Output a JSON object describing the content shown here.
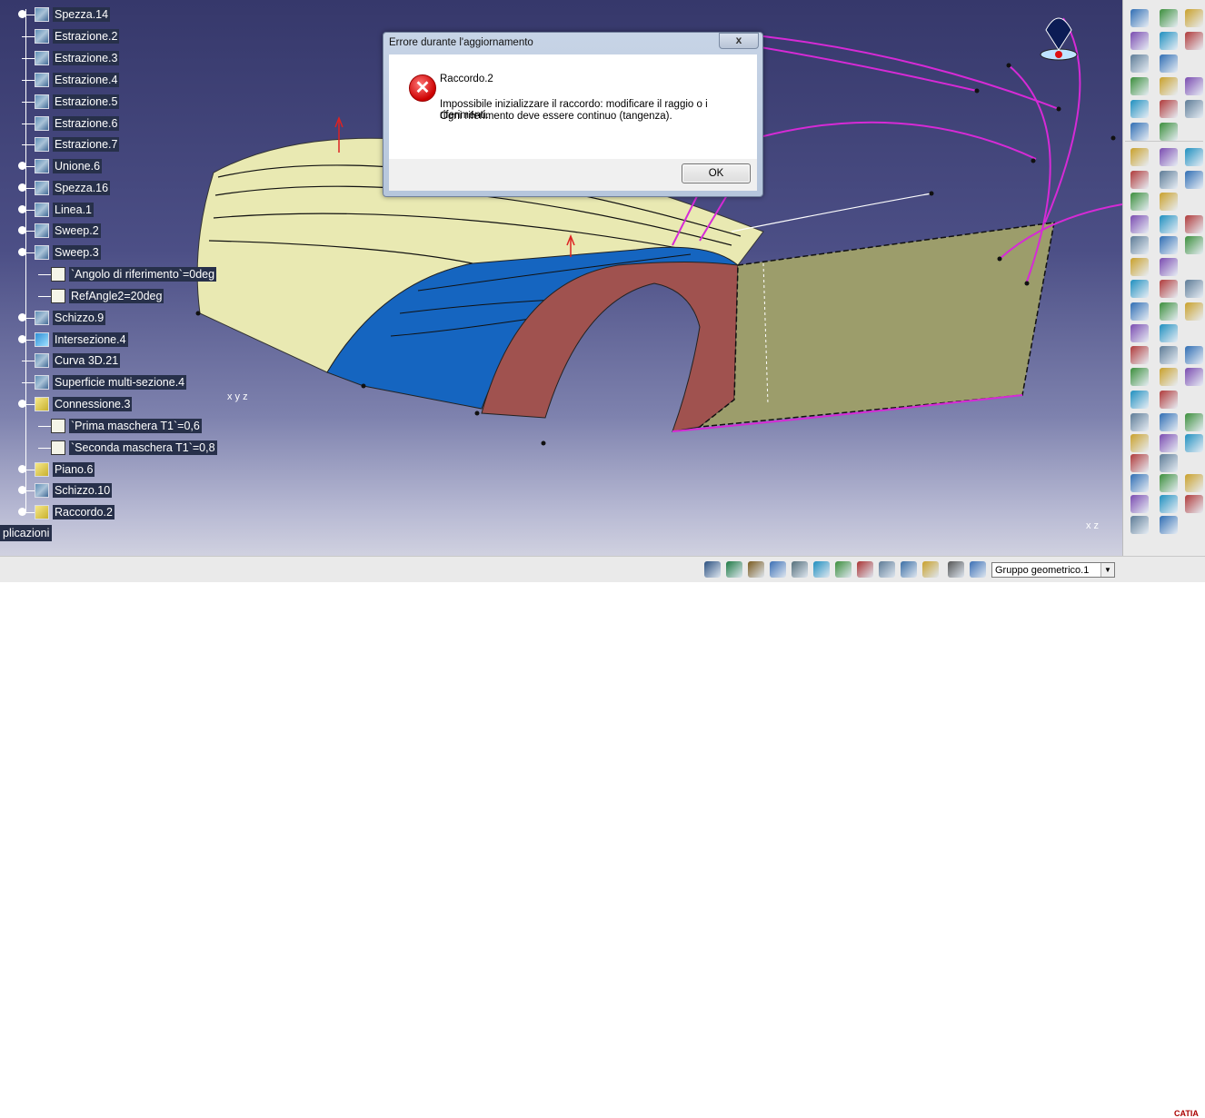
{
  "tree": {
    "items": [
      {
        "label": "Spezza.14",
        "icon": "split-icon"
      },
      {
        "label": "Estrazione.2",
        "icon": "extract-icon"
      },
      {
        "label": "Estrazione.3",
        "icon": "extract-icon"
      },
      {
        "label": "Estrazione.4",
        "icon": "extract-icon"
      },
      {
        "label": "Estrazione.5",
        "icon": "extract-icon"
      },
      {
        "label": "Estrazione.6",
        "icon": "extract-icon"
      },
      {
        "label": "Estrazione.7",
        "icon": "extract-icon"
      },
      {
        "label": "Unione.6",
        "icon": "join-icon"
      },
      {
        "label": "Spezza.16",
        "icon": "split-icon"
      },
      {
        "label": "Linea.1",
        "icon": "line-icon"
      },
      {
        "label": "Sweep.2",
        "icon": "sweep-icon"
      },
      {
        "label": "Sweep.3",
        "icon": "sweep-icon"
      },
      {
        "label": "`Angolo di riferimento`=0deg",
        "icon": "parameter-icon"
      },
      {
        "label": "RefAngle2=20deg",
        "icon": "parameter-icon"
      },
      {
        "label": "Schizzo.9",
        "icon": "sketch-icon"
      },
      {
        "label": "Intersezione.4",
        "icon": "intersection-icon"
      },
      {
        "label": "Curva 3D.21",
        "icon": "curve-3d-icon"
      },
      {
        "label": "Superficie multi-sezione.4",
        "icon": "multi-section-surface-icon"
      },
      {
        "label": "Connessione.3",
        "icon": "blend-icon"
      },
      {
        "label": "`Prima maschera T1`=0,6",
        "icon": "parameter-icon"
      },
      {
        "label": "`Seconda maschera T1`=0,8",
        "icon": "parameter-icon"
      },
      {
        "label": "Piano.6",
        "icon": "plane-icon"
      },
      {
        "label": "Schizzo.10",
        "icon": "sketch-icon"
      },
      {
        "label": "Raccordo.2",
        "icon": "fillet-icon"
      }
    ],
    "applications_label": "plicazioni"
  },
  "dialog": {
    "title": "Errore durante l'aggiornamento",
    "close_label": "x",
    "error_name": "Raccordo.2",
    "message_line1": "Impossibile inizializzare il raccordo: modificare il raggio o i riferimenti.",
    "message_line2": "Ogni riferimento deve essere continuo (tangenza).",
    "ok_label": "OK",
    "icon": "error-icon"
  },
  "status_bar": {
    "geometric_set": "Gruppo geometrico.1",
    "brand": "CATIA"
  },
  "colors": {
    "viewport_top": "#36386b",
    "surface_yellow": "#e9e9b2",
    "surface_blue": "#1565c0",
    "surface_red": "#a0524f",
    "surface_olive": "#9c9d6b",
    "curve_magenta": "#d62ad6"
  }
}
